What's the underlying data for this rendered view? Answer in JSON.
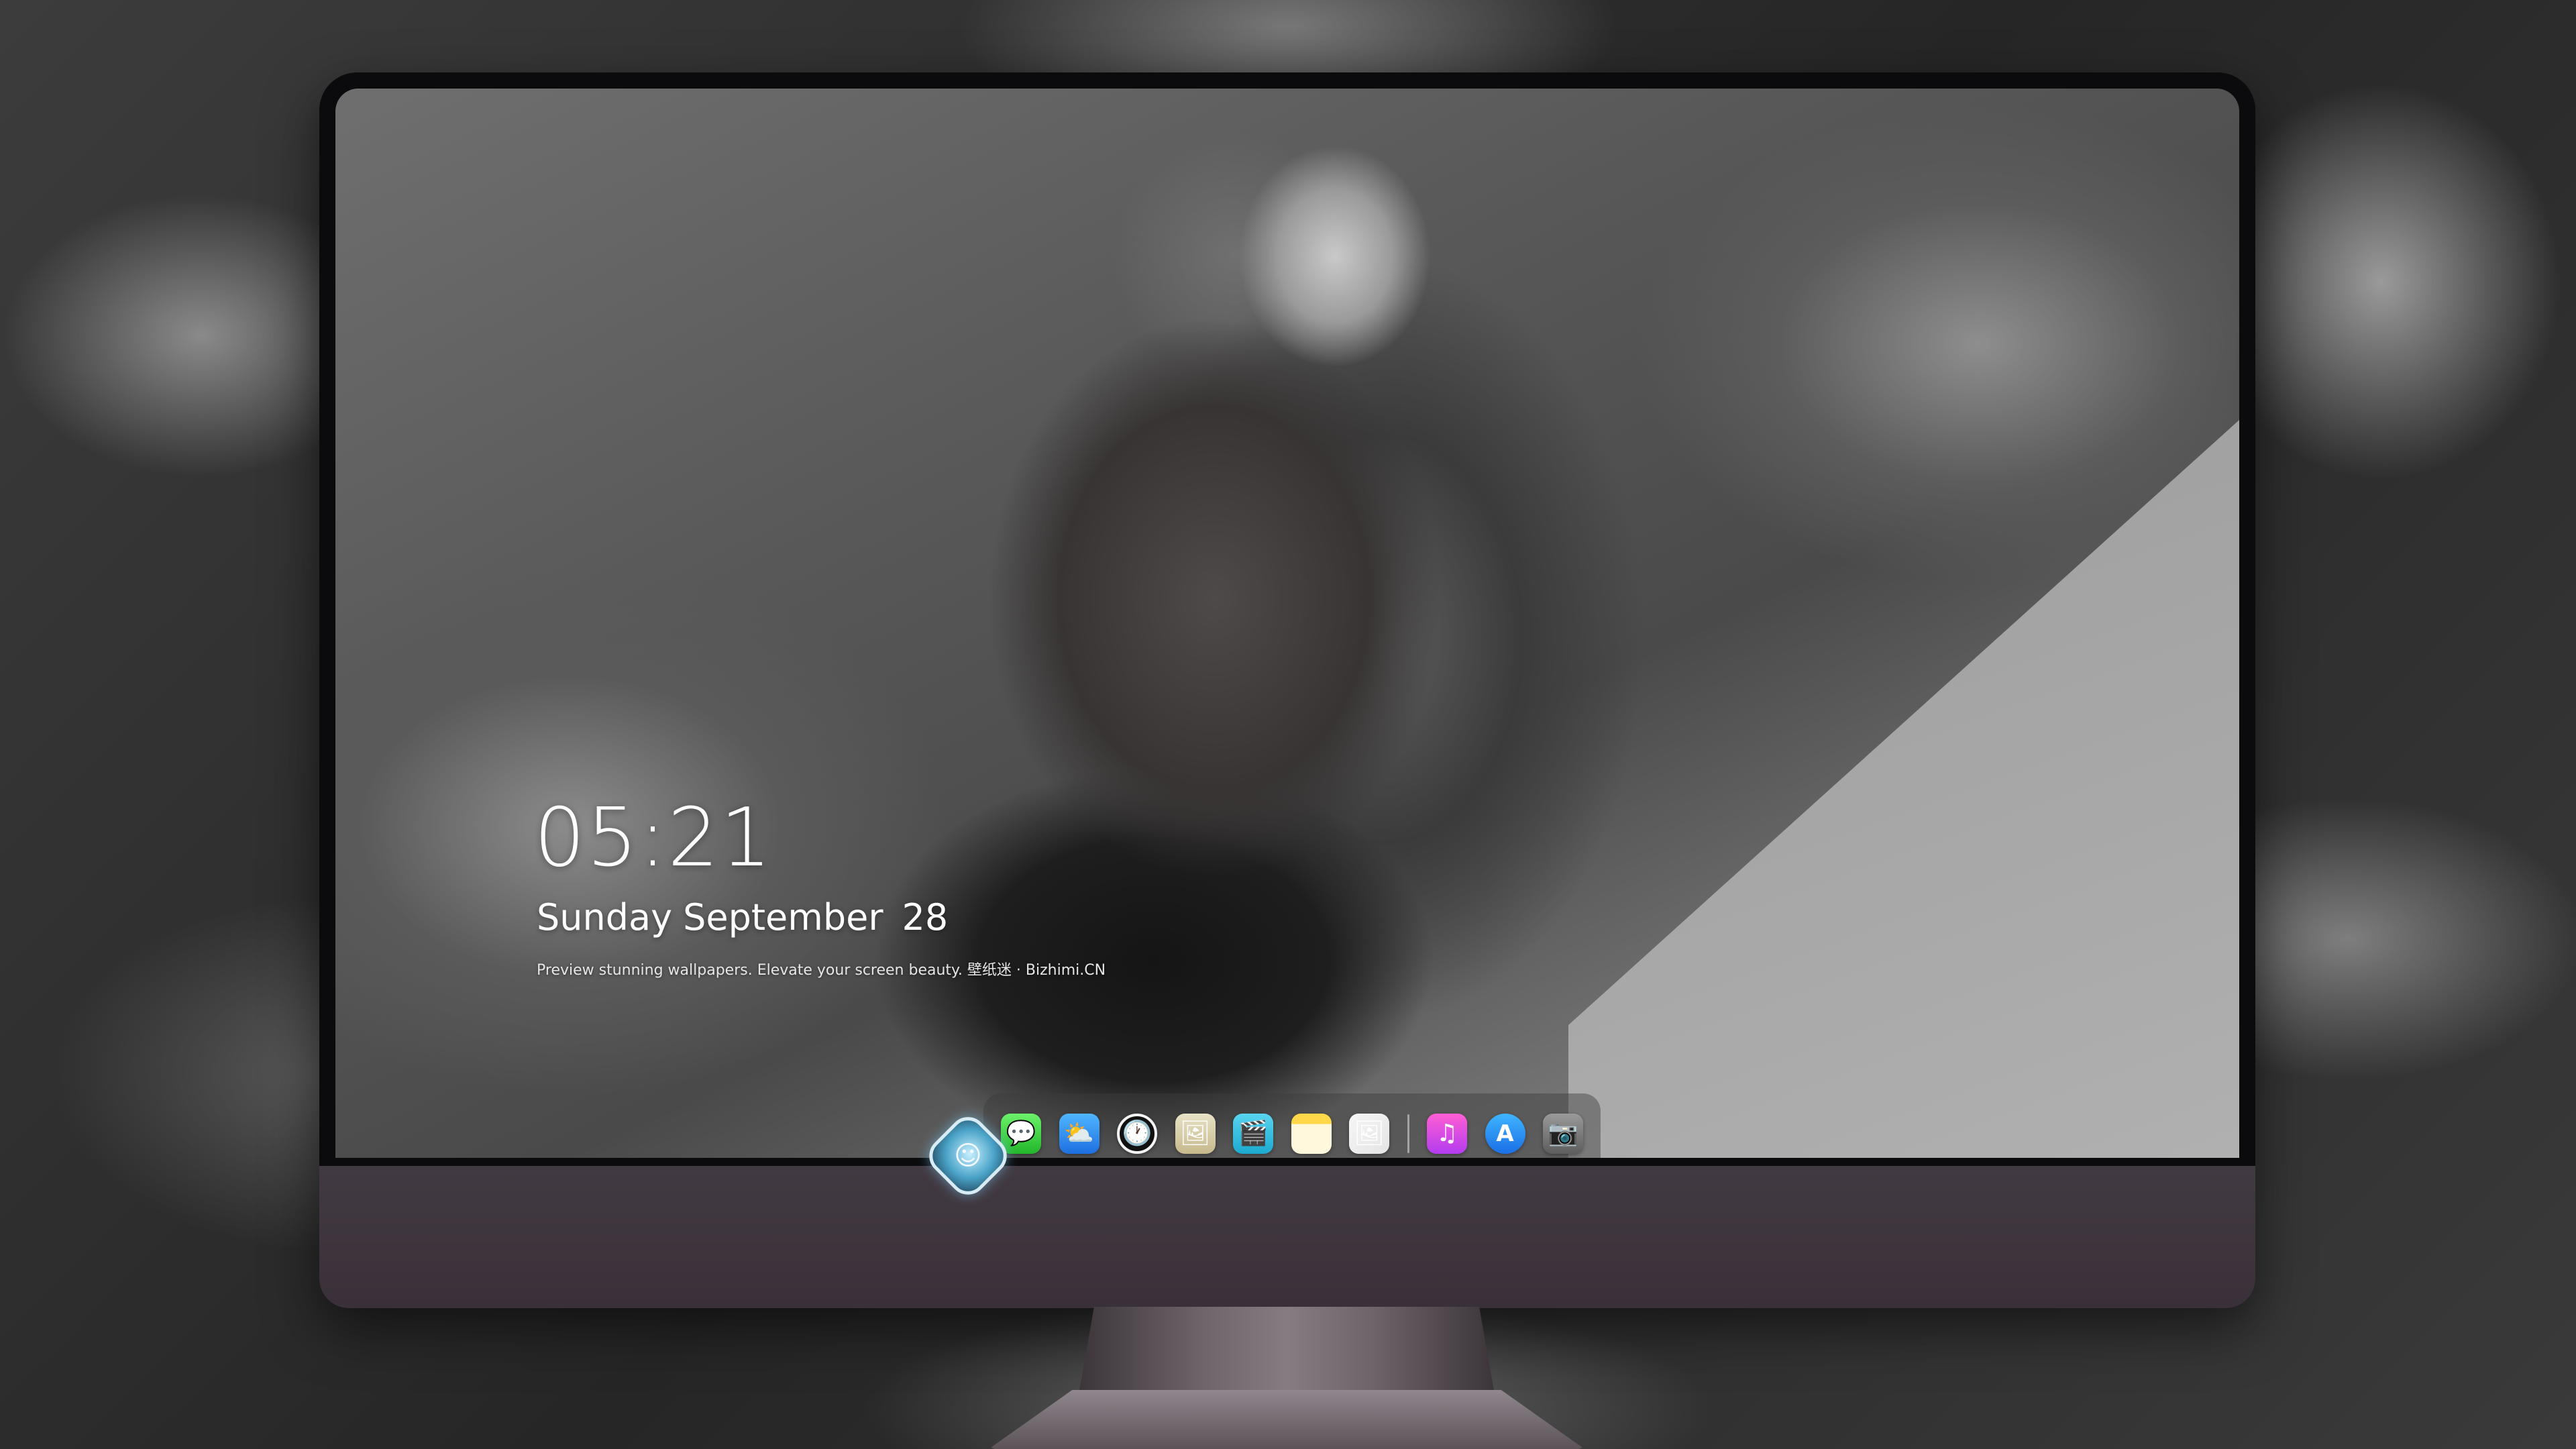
{
  "lock_screen": {
    "time": "05:21",
    "weekday": "Sunday",
    "month": "September",
    "day": "28",
    "tagline": "Preview stunning wallpapers. Elevate your screen beauty. 壁纸迷 · Bizhimi.CN"
  },
  "dock": {
    "apps": [
      {
        "name": "messages",
        "icon": "speech-bubble-icon",
        "glyph": "💬"
      },
      {
        "name": "weather",
        "icon": "cloud-sun-icon",
        "glyph": "⛅"
      },
      {
        "name": "clock",
        "icon": "clock-icon",
        "glyph": "🕐"
      },
      {
        "name": "preview",
        "icon": "preview-icon",
        "glyph": "🖼"
      },
      {
        "name": "claquette",
        "icon": "clapperboard-icon",
        "glyph": "🎬"
      },
      {
        "name": "notes",
        "icon": "notes-icon",
        "glyph": ""
      },
      {
        "name": "photos",
        "icon": "photos-icon",
        "glyph": "🖼"
      },
      {
        "name": "music",
        "icon": "music-note-icon",
        "glyph": "♫"
      },
      {
        "name": "app-store",
        "icon": "app-store-icon",
        "glyph": "A"
      },
      {
        "name": "camera",
        "icon": "camera-icon",
        "glyph": "📷"
      }
    ]
  },
  "chin": {
    "logo_icon": "mascot-logo-icon",
    "logo_glyph": "☺"
  },
  "colors": {
    "chin": "#3f373f",
    "bezel": "#0b0b0d",
    "messages": "#22b52a",
    "weather": "#1e6fe0",
    "music": "#d84ee8",
    "app_store": "#2a8ef2"
  }
}
